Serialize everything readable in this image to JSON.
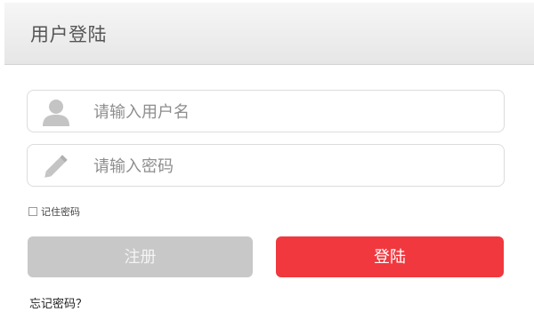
{
  "header": {
    "title": "用户登陆"
  },
  "form": {
    "username": {
      "placeholder": "请输入用户名",
      "value": "",
      "icon": "user-icon"
    },
    "password": {
      "placeholder": "请输入密码",
      "value": "",
      "icon": "pencil-icon"
    },
    "remember_label": "记住密码",
    "remember_checked": false,
    "register_label": "注册",
    "login_label": "登陆",
    "forgot_label": "忘记密码？"
  },
  "colors": {
    "login_button": "#f0383e",
    "register_button": "#c8c8c8",
    "icon_gray": "#c4c4c4"
  }
}
